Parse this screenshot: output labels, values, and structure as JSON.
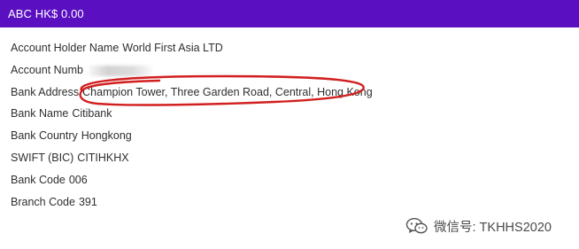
{
  "header": {
    "label": "ABC HK$ 0.00",
    "background_color": "#5a0fc1"
  },
  "details": {
    "account_holder_name": {
      "label": "Account Holder Name",
      "value": "World First Asia LTD"
    },
    "account_number": {
      "label": "Account Numb"
    },
    "bank_address": {
      "label": "Bank Address",
      "value": "Champion Tower, Three Garden Road, Central, Hong Kong"
    },
    "bank_name": {
      "label": "Bank Name",
      "value": "Citibank"
    },
    "bank_country": {
      "label": "Bank Country",
      "value": "Hongkong"
    },
    "swift": {
      "label": "SWIFT (BIC)",
      "value": "CITIHKHX"
    },
    "bank_code": {
      "label": "Bank Code",
      "value": "006"
    },
    "branch_code": {
      "label": "Branch Code",
      "value": "391"
    }
  },
  "annotation": {
    "color": "#d21f1f"
  },
  "watermark": {
    "text": "微信号: TKHHS2020",
    "icon": "wechat-logo-icon"
  }
}
